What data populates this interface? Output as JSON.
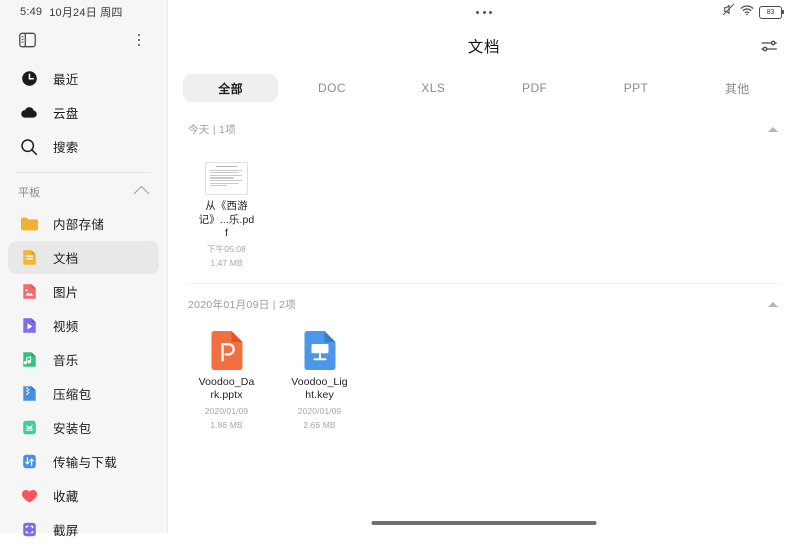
{
  "status_bar": {
    "time": "5:49",
    "date": "10月24日 周四",
    "battery_level": "83",
    "icons": [
      "mute-icon",
      "wifi-icon",
      "battery-icon"
    ]
  },
  "sidebar": {
    "toggle_icon": "sidebar-toggle-icon",
    "overflow_icon": "more-vertical-icon",
    "quick_items": [
      {
        "label": "最近",
        "icon": "clock-icon"
      },
      {
        "label": "云盘",
        "icon": "cloud-icon"
      },
      {
        "label": "搜索",
        "icon": "search-icon"
      }
    ],
    "group": {
      "label": "平板",
      "collapse_icon": "chevron-up-icon"
    },
    "items": [
      {
        "label": "内部存储",
        "icon": "folder-icon",
        "color": "#f2b134",
        "selected": false
      },
      {
        "label": "文档",
        "icon": "document-icon",
        "color": "#f5b52c",
        "selected": true
      },
      {
        "label": "图片",
        "icon": "image-icon",
        "color": "#f2696e",
        "selected": false
      },
      {
        "label": "视频",
        "icon": "video-icon",
        "color": "#7b6cf0",
        "selected": false
      },
      {
        "label": "音乐",
        "icon": "music-icon",
        "color": "#33c07f",
        "selected": false
      },
      {
        "label": "压缩包",
        "icon": "archive-icon",
        "color": "#4a90e2",
        "selected": false
      },
      {
        "label": "安装包",
        "icon": "apk-icon",
        "color": "#3fcf8e",
        "selected": false
      },
      {
        "label": "传输与下载",
        "icon": "transfer-icon",
        "color": "#4a90e2",
        "selected": false
      },
      {
        "label": "收藏",
        "icon": "heart-icon",
        "color": "#f2565c",
        "selected": false
      },
      {
        "label": "截屏",
        "icon": "screenshot-icon",
        "color": "#7b6cf0",
        "selected": false
      }
    ]
  },
  "header": {
    "dots_icon": "more-horizontal-icon",
    "title": "文档",
    "filter_icon": "sort-filter-icon"
  },
  "tabs": [
    {
      "label": "全部",
      "active": true
    },
    {
      "label": "DOC",
      "active": false
    },
    {
      "label": "XLS",
      "active": false
    },
    {
      "label": "PDF",
      "active": false
    },
    {
      "label": "PPT",
      "active": false
    },
    {
      "label": "其他",
      "active": false
    }
  ],
  "sections": [
    {
      "header": "今天 | 1项",
      "files": [
        {
          "name": "从《西游记》...乐.pdf",
          "time": "下午05:08",
          "size": "1.47 MB",
          "icon": "pdf-document-thumbnail"
        }
      ]
    },
    {
      "header": "2020年01月09日 | 2项",
      "files": [
        {
          "name": "Voodoo_Dark.pptx",
          "time": "2020/01/09",
          "size": "1.86 MB",
          "icon": "pptx-file-icon",
          "color": "#f2703f"
        },
        {
          "name": "Voodoo_Light.key",
          "time": "2020/01/09",
          "size": "2.66 MB",
          "icon": "keynote-file-icon",
          "color": "#4d97e8"
        }
      ]
    }
  ],
  "home_indicator": "home-indicator"
}
